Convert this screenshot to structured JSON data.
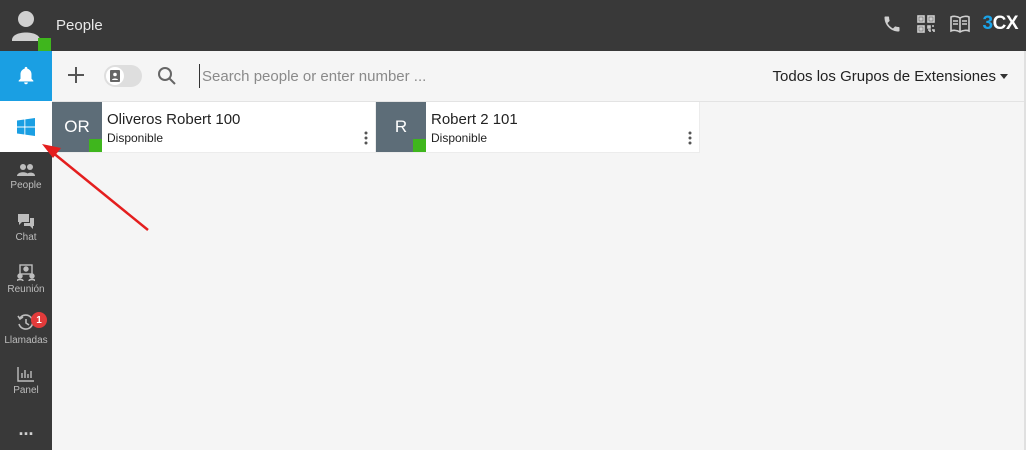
{
  "header": {
    "title": "People",
    "brand_prefix": "3",
    "brand_suffix": "CX",
    "icons": [
      "phone-icon",
      "qr-code-icon",
      "book-icon"
    ]
  },
  "sidebar": {
    "items": [
      {
        "label": "People",
        "icon": "people-icon"
      },
      {
        "label": "Chat",
        "icon": "chat-icon"
      },
      {
        "label": "Reunión",
        "icon": "meeting-icon"
      },
      {
        "label": "Llamadas",
        "icon": "call-history-icon",
        "badge": "1"
      },
      {
        "label": "Panel",
        "icon": "panel-icon"
      }
    ],
    "more": "..."
  },
  "toolbar": {
    "search_placeholder": "Search people or enter number ...",
    "group_filter": "Todos los Grupos de Extensiones"
  },
  "contacts": [
    {
      "initials": "OR",
      "name": "Oliveros Robert 100",
      "status": "Disponible"
    },
    {
      "initials": "R",
      "name": "Robert 2 101",
      "status": "Disponible"
    }
  ],
  "colors": {
    "accent": "#1a9fe3",
    "presence": "#3fb61d",
    "dark": "#393939",
    "badge": "#e23b3b",
    "arrow": "#e41e1e"
  }
}
